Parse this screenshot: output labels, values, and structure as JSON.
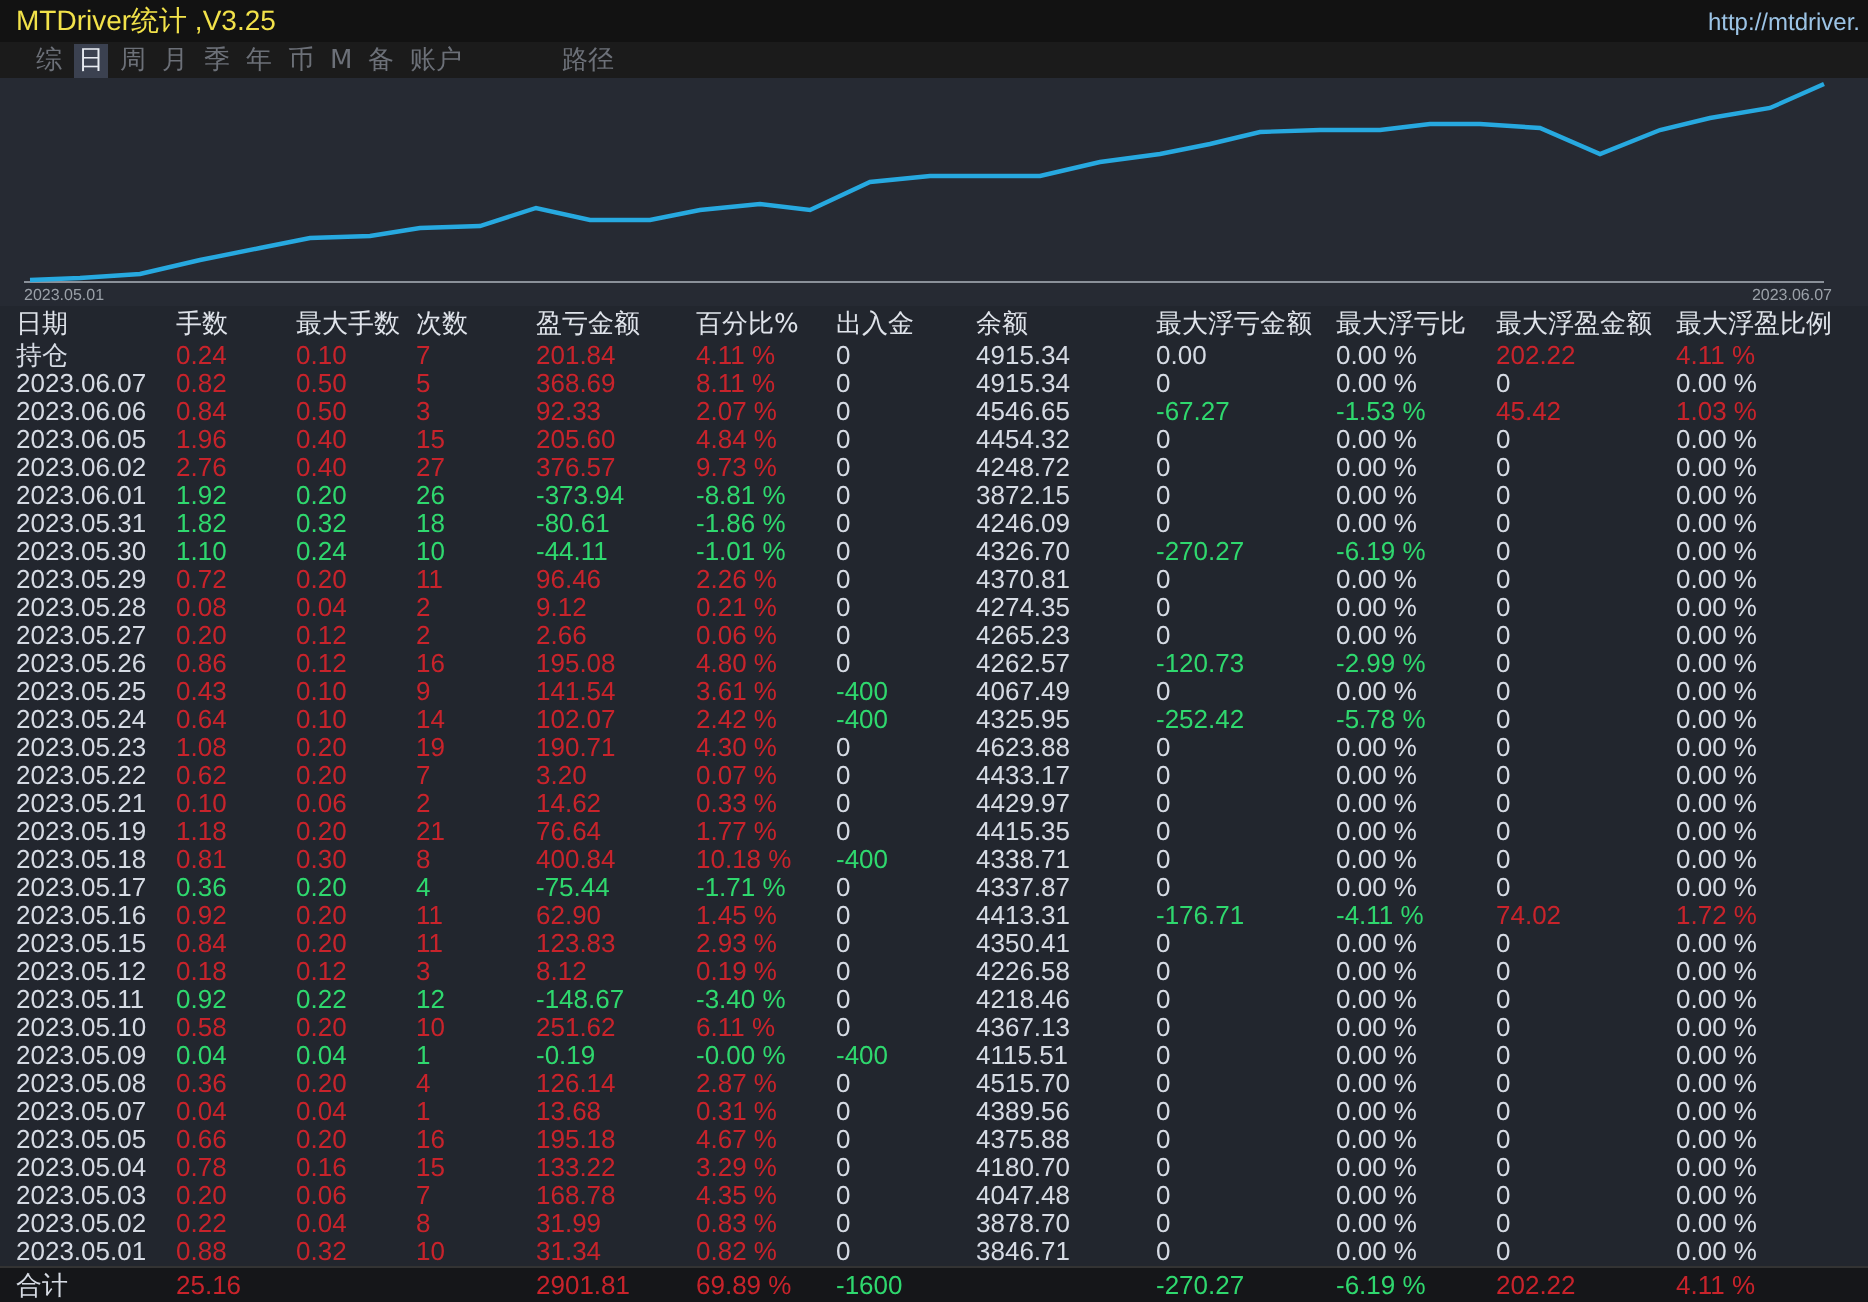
{
  "window": {
    "title": "MTDriver统计 ,V3.25",
    "url": "http://mtdriver."
  },
  "tabs": [
    {
      "label": "综",
      "selected": false
    },
    {
      "label": "日",
      "selected": true
    },
    {
      "label": "周",
      "selected": false
    },
    {
      "label": "月",
      "selected": false
    },
    {
      "label": "季",
      "selected": false
    },
    {
      "label": "年",
      "selected": false
    },
    {
      "label": "币",
      "selected": false
    },
    {
      "label": "M",
      "selected": false
    },
    {
      "label": "备",
      "selected": false
    },
    {
      "label": "账户",
      "selected": false
    },
    {
      "label": "路径",
      "selected": false
    }
  ],
  "balance_chart": {
    "start_date": "2023.05.01",
    "end_date": "2023.06.07"
  },
  "table": {
    "columns": [
      "日期",
      "手数",
      "最大手数",
      "次数",
      "盈亏金额",
      "百分比%",
      "出入金",
      "余额",
      "最大浮亏金额",
      "最大浮亏比",
      "最大浮盈金额",
      "最大浮盈比例"
    ],
    "rows": [
      {
        "cells": [
          "持仓",
          "0.24",
          "0.10",
          "7",
          "201.84",
          "4.11 %",
          "0",
          "4915.34",
          "0.00",
          "0.00 %",
          "202.22",
          "4.11 %"
        ],
        "profit": true,
        "withdrawal": false,
        "drawdown": false,
        "floating_profit": true
      },
      {
        "cells": [
          "2023.06.07",
          "0.82",
          "0.50",
          "5",
          "368.69",
          "8.11 %",
          "0",
          "4915.34",
          "0",
          "0.00 %",
          "0",
          "0.00 %"
        ],
        "profit": true,
        "withdrawal": false,
        "drawdown": false,
        "floating_profit": false
      },
      {
        "cells": [
          "2023.06.06",
          "0.84",
          "0.50",
          "3",
          "92.33",
          "2.07 %",
          "0",
          "4546.65",
          "-67.27",
          "-1.53 %",
          "45.42",
          "1.03 %"
        ],
        "profit": true,
        "withdrawal": false,
        "drawdown": true,
        "floating_profit": true
      },
      {
        "cells": [
          "2023.06.05",
          "1.96",
          "0.40",
          "15",
          "205.60",
          "4.84 %",
          "0",
          "4454.32",
          "0",
          "0.00 %",
          "0",
          "0.00 %"
        ],
        "profit": true,
        "withdrawal": false,
        "drawdown": false,
        "floating_profit": false
      },
      {
        "cells": [
          "2023.06.02",
          "2.76",
          "0.40",
          "27",
          "376.57",
          "9.73 %",
          "0",
          "4248.72",
          "0",
          "0.00 %",
          "0",
          "0.00 %"
        ],
        "profit": true,
        "withdrawal": false,
        "drawdown": false,
        "floating_profit": false
      },
      {
        "cells": [
          "2023.06.01",
          "1.92",
          "0.20",
          "26",
          "-373.94",
          "-8.81 %",
          "0",
          "3872.15",
          "0",
          "0.00 %",
          "0",
          "0.00 %"
        ],
        "profit": false,
        "withdrawal": false,
        "drawdown": false,
        "floating_profit": false
      },
      {
        "cells": [
          "2023.05.31",
          "1.82",
          "0.32",
          "18",
          "-80.61",
          "-1.86 %",
          "0",
          "4246.09",
          "0",
          "0.00 %",
          "0",
          "0.00 %"
        ],
        "profit": false,
        "withdrawal": false,
        "drawdown": false,
        "floating_profit": false
      },
      {
        "cells": [
          "2023.05.30",
          "1.10",
          "0.24",
          "10",
          "-44.11",
          "-1.01 %",
          "0",
          "4326.70",
          "-270.27",
          "-6.19 %",
          "0",
          "0.00 %"
        ],
        "profit": false,
        "withdrawal": false,
        "drawdown": true,
        "floating_profit": false
      },
      {
        "cells": [
          "2023.05.29",
          "0.72",
          "0.20",
          "11",
          "96.46",
          "2.26 %",
          "0",
          "4370.81",
          "0",
          "0.00 %",
          "0",
          "0.00 %"
        ],
        "profit": true,
        "withdrawal": false,
        "drawdown": false,
        "floating_profit": false
      },
      {
        "cells": [
          "2023.05.28",
          "0.08",
          "0.04",
          "2",
          "9.12",
          "0.21 %",
          "0",
          "4274.35",
          "0",
          "0.00 %",
          "0",
          "0.00 %"
        ],
        "profit": true,
        "withdrawal": false,
        "drawdown": false,
        "floating_profit": false
      },
      {
        "cells": [
          "2023.05.27",
          "0.20",
          "0.12",
          "2",
          "2.66",
          "0.06 %",
          "0",
          "4265.23",
          "0",
          "0.00 %",
          "0",
          "0.00 %"
        ],
        "profit": true,
        "withdrawal": false,
        "drawdown": false,
        "floating_profit": false
      },
      {
        "cells": [
          "2023.05.26",
          "0.86",
          "0.12",
          "16",
          "195.08",
          "4.80 %",
          "0",
          "4262.57",
          "-120.73",
          "-2.99 %",
          "0",
          "0.00 %"
        ],
        "profit": true,
        "withdrawal": false,
        "drawdown": true,
        "floating_profit": false
      },
      {
        "cells": [
          "2023.05.25",
          "0.43",
          "0.10",
          "9",
          "141.54",
          "3.61 %",
          "-400",
          "4067.49",
          "0",
          "0.00 %",
          "0",
          "0.00 %"
        ],
        "profit": true,
        "withdrawal": true,
        "drawdown": false,
        "floating_profit": false
      },
      {
        "cells": [
          "2023.05.24",
          "0.64",
          "0.10",
          "14",
          "102.07",
          "2.42 %",
          "-400",
          "4325.95",
          "-252.42",
          "-5.78 %",
          "0",
          "0.00 %"
        ],
        "profit": true,
        "withdrawal": true,
        "drawdown": true,
        "floating_profit": false
      },
      {
        "cells": [
          "2023.05.23",
          "1.08",
          "0.20",
          "19",
          "190.71",
          "4.30 %",
          "0",
          "4623.88",
          "0",
          "0.00 %",
          "0",
          "0.00 %"
        ],
        "profit": true,
        "withdrawal": false,
        "drawdown": false,
        "floating_profit": false
      },
      {
        "cells": [
          "2023.05.22",
          "0.62",
          "0.20",
          "7",
          "3.20",
          "0.07 %",
          "0",
          "4433.17",
          "0",
          "0.00 %",
          "0",
          "0.00 %"
        ],
        "profit": true,
        "withdrawal": false,
        "drawdown": false,
        "floating_profit": false
      },
      {
        "cells": [
          "2023.05.21",
          "0.10",
          "0.06",
          "2",
          "14.62",
          "0.33 %",
          "0",
          "4429.97",
          "0",
          "0.00 %",
          "0",
          "0.00 %"
        ],
        "profit": true,
        "withdrawal": false,
        "drawdown": false,
        "floating_profit": false
      },
      {
        "cells": [
          "2023.05.19",
          "1.18",
          "0.20",
          "21",
          "76.64",
          "1.77 %",
          "0",
          "4415.35",
          "0",
          "0.00 %",
          "0",
          "0.00 %"
        ],
        "profit": true,
        "withdrawal": false,
        "drawdown": false,
        "floating_profit": false
      },
      {
        "cells": [
          "2023.05.18",
          "0.81",
          "0.30",
          "8",
          "400.84",
          "10.18 %",
          "-400",
          "4338.71",
          "0",
          "0.00 %",
          "0",
          "0.00 %"
        ],
        "profit": true,
        "withdrawal": true,
        "drawdown": false,
        "floating_profit": false
      },
      {
        "cells": [
          "2023.05.17",
          "0.36",
          "0.20",
          "4",
          "-75.44",
          "-1.71 %",
          "0",
          "4337.87",
          "0",
          "0.00 %",
          "0",
          "0.00 %"
        ],
        "profit": false,
        "withdrawal": false,
        "drawdown": false,
        "floating_profit": false
      },
      {
        "cells": [
          "2023.05.16",
          "0.92",
          "0.20",
          "11",
          "62.90",
          "1.45 %",
          "0",
          "4413.31",
          "-176.71",
          "-4.11 %",
          "74.02",
          "1.72 %"
        ],
        "profit": true,
        "withdrawal": false,
        "drawdown": true,
        "floating_profit": true
      },
      {
        "cells": [
          "2023.05.15",
          "0.84",
          "0.20",
          "11",
          "123.83",
          "2.93 %",
          "0",
          "4350.41",
          "0",
          "0.00 %",
          "0",
          "0.00 %"
        ],
        "profit": true,
        "withdrawal": false,
        "drawdown": false,
        "floating_profit": false
      },
      {
        "cells": [
          "2023.05.12",
          "0.18",
          "0.12",
          "3",
          "8.12",
          "0.19 %",
          "0",
          "4226.58",
          "0",
          "0.00 %",
          "0",
          "0.00 %"
        ],
        "profit": true,
        "withdrawal": false,
        "drawdown": false,
        "floating_profit": false
      },
      {
        "cells": [
          "2023.05.11",
          "0.92",
          "0.22",
          "12",
          "-148.67",
          "-3.40 %",
          "0",
          "4218.46",
          "0",
          "0.00 %",
          "0",
          "0.00 %"
        ],
        "profit": false,
        "withdrawal": false,
        "drawdown": false,
        "floating_profit": false
      },
      {
        "cells": [
          "2023.05.10",
          "0.58",
          "0.20",
          "10",
          "251.62",
          "6.11 %",
          "0",
          "4367.13",
          "0",
          "0.00 %",
          "0",
          "0.00 %"
        ],
        "profit": true,
        "withdrawal": false,
        "drawdown": false,
        "floating_profit": false
      },
      {
        "cells": [
          "2023.05.09",
          "0.04",
          "0.04",
          "1",
          "-0.19",
          "-0.00 %",
          "-400",
          "4115.51",
          "0",
          "0.00 %",
          "0",
          "0.00 %"
        ],
        "profit": false,
        "withdrawal": true,
        "drawdown": false,
        "floating_profit": false
      },
      {
        "cells": [
          "2023.05.08",
          "0.36",
          "0.20",
          "4",
          "126.14",
          "2.87 %",
          "0",
          "4515.70",
          "0",
          "0.00 %",
          "0",
          "0.00 %"
        ],
        "profit": true,
        "withdrawal": false,
        "drawdown": false,
        "floating_profit": false
      },
      {
        "cells": [
          "2023.05.07",
          "0.04",
          "0.04",
          "1",
          "13.68",
          "0.31 %",
          "0",
          "4389.56",
          "0",
          "0.00 %",
          "0",
          "0.00 %"
        ],
        "profit": true,
        "withdrawal": false,
        "drawdown": false,
        "floating_profit": false
      },
      {
        "cells": [
          "2023.05.05",
          "0.66",
          "0.20",
          "16",
          "195.18",
          "4.67 %",
          "0",
          "4375.88",
          "0",
          "0.00 %",
          "0",
          "0.00 %"
        ],
        "profit": true,
        "withdrawal": false,
        "drawdown": false,
        "floating_profit": false
      },
      {
        "cells": [
          "2023.05.04",
          "0.78",
          "0.16",
          "15",
          "133.22",
          "3.29 %",
          "0",
          "4180.70",
          "0",
          "0.00 %",
          "0",
          "0.00 %"
        ],
        "profit": true,
        "withdrawal": false,
        "drawdown": false,
        "floating_profit": false
      },
      {
        "cells": [
          "2023.05.03",
          "0.20",
          "0.06",
          "7",
          "168.78",
          "4.35 %",
          "0",
          "4047.48",
          "0",
          "0.00 %",
          "0",
          "0.00 %"
        ],
        "profit": true,
        "withdrawal": false,
        "drawdown": false,
        "floating_profit": false
      },
      {
        "cells": [
          "2023.05.02",
          "0.22",
          "0.04",
          "8",
          "31.99",
          "0.83 %",
          "0",
          "3878.70",
          "0",
          "0.00 %",
          "0",
          "0.00 %"
        ],
        "profit": true,
        "withdrawal": false,
        "drawdown": false,
        "floating_profit": false
      },
      {
        "cells": [
          "2023.05.01",
          "0.88",
          "0.32",
          "10",
          "31.34",
          "0.82 %",
          "0",
          "3846.71",
          "0",
          "0.00 %",
          "0",
          "0.00 %"
        ],
        "profit": true,
        "withdrawal": false,
        "drawdown": false,
        "floating_profit": false
      }
    ],
    "totals": {
      "label": "合计",
      "lots": "25.16",
      "pnl": "2901.81",
      "pct": "69.89 %",
      "deposit": "-1600",
      "max_dd": "-270.27",
      "max_dd_pct": "-6.19 %",
      "max_fp": "202.22",
      "max_fp_pct": "4.11 %",
      "profit": true,
      "withdrawal": true,
      "drawdown": true,
      "floating_profit": true
    }
  }
}
